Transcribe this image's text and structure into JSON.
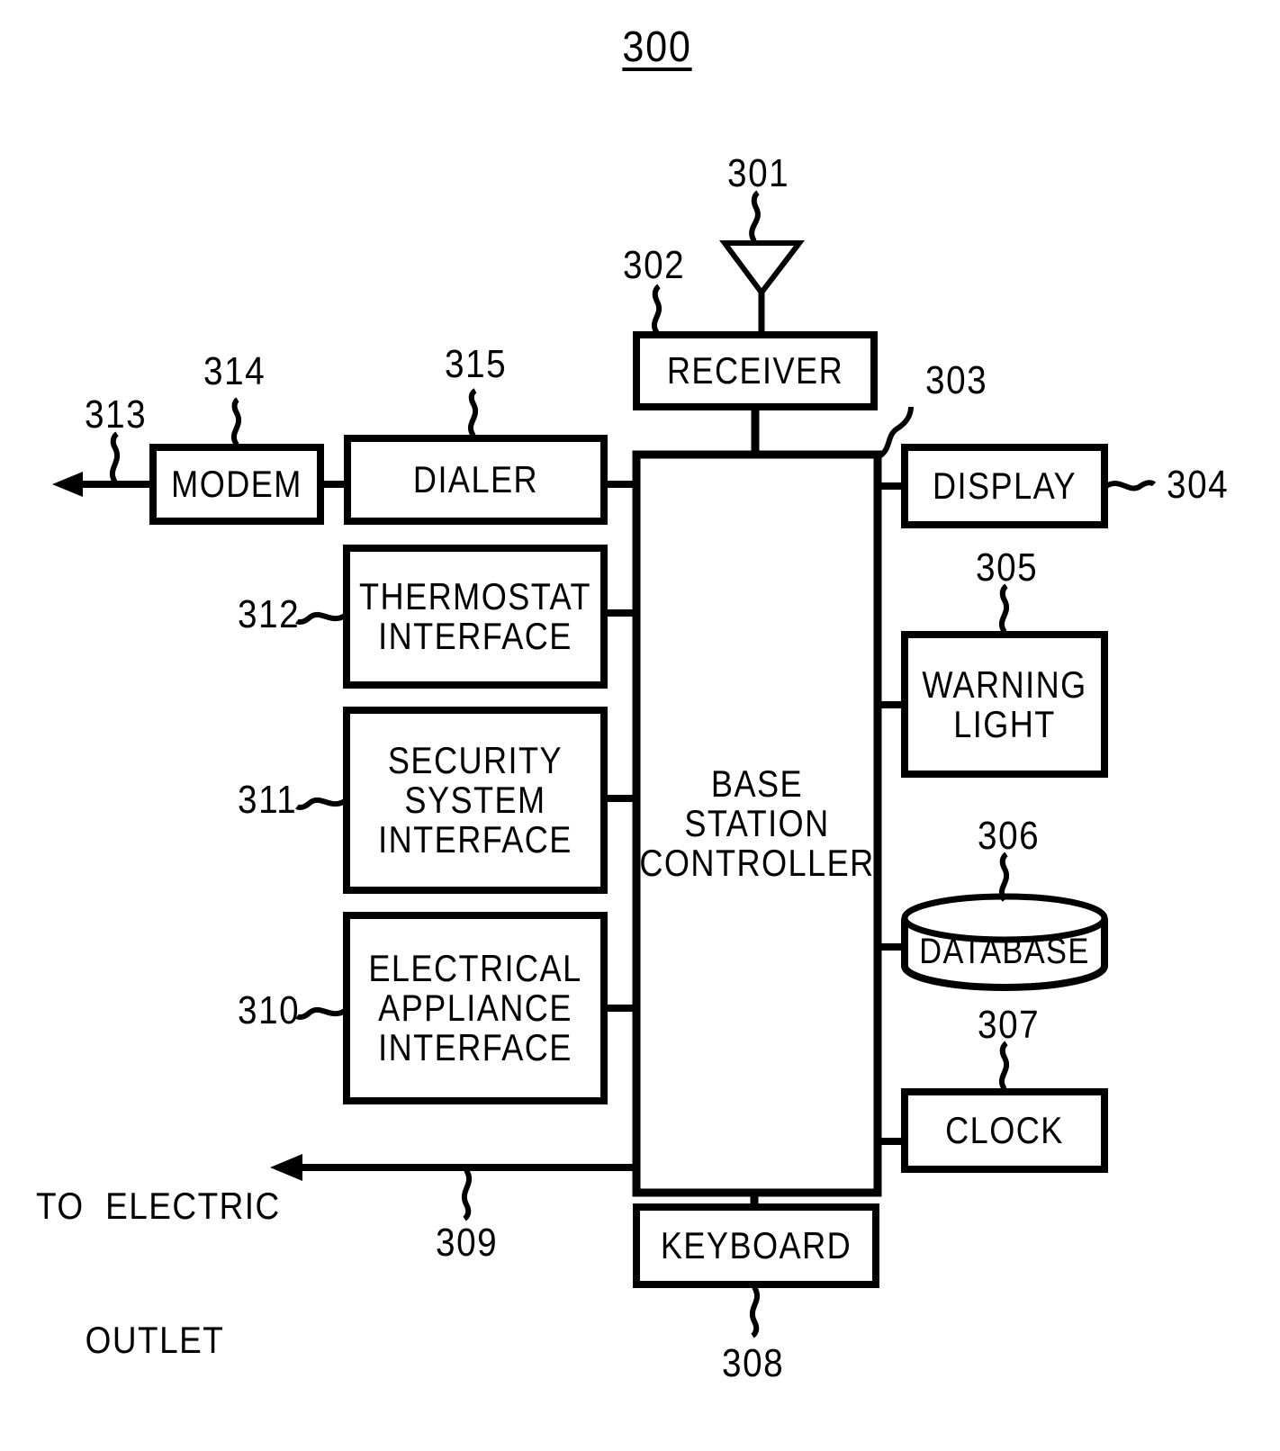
{
  "figure": {
    "number": "300",
    "type": "block-diagram",
    "title_label": "300"
  },
  "blocks": [
    {
      "id": "receiver",
      "label": "RECEIVER",
      "ref": "302",
      "shape": "rect"
    },
    {
      "id": "controller",
      "label": "BASE\nSTATION\nCONTROLLER",
      "ref": "303",
      "shape": "rect"
    },
    {
      "id": "display",
      "label": "DISPLAY",
      "ref": "304",
      "shape": "rect"
    },
    {
      "id": "warning",
      "label": "WARNING\nLIGHT",
      "ref": "305",
      "shape": "rect"
    },
    {
      "id": "database",
      "label": "DATABASE",
      "ref": "306",
      "shape": "cylinder"
    },
    {
      "id": "clock",
      "label": "CLOCK",
      "ref": "307",
      "shape": "rect"
    },
    {
      "id": "keyboard",
      "label": "KEYBOARD",
      "ref": "308",
      "shape": "rect"
    },
    {
      "id": "appliance",
      "label": "ELECTRICAL\nAPPLIANCE\nINTERFACE",
      "ref": "310",
      "shape": "rect"
    },
    {
      "id": "security",
      "label": "SECURITY\nSYSTEM\nINTERFACE",
      "ref": "311",
      "shape": "rect"
    },
    {
      "id": "thermostat",
      "label": "THERMOSTAT\nINTERFACE",
      "ref": "312",
      "shape": "rect"
    },
    {
      "id": "modem",
      "label": "MODEM",
      "ref": "314",
      "shape": "rect"
    },
    {
      "id": "dialer",
      "label": "DIALER",
      "ref": "315",
      "shape": "rect"
    }
  ],
  "block_text": {
    "receiver": "RECEIVER",
    "controller_line1": "BASE",
    "controller_line2": "STATION",
    "controller_line3": "CONTROLLER",
    "display": "DISPLAY",
    "warning_line1": "WARNING",
    "warning_line2": "LIGHT",
    "database": "DATABASE",
    "clock": "CLOCK",
    "keyboard": "KEYBOARD",
    "appliance_line1": "ELECTRICAL",
    "appliance_line2": "APPLIANCE",
    "appliance_line3": "INTERFACE",
    "security_line1": "SECURITY",
    "security_line2": "SYSTEM",
    "security_line3": "INTERFACE",
    "thermostat_line1": "THERMOSTAT",
    "thermostat_line2": "INTERFACE",
    "modem": "MODEM",
    "dialer": "DIALER"
  },
  "reference_numerals": {
    "antenna": "301",
    "receiver": "302",
    "controller": "303",
    "display": "304",
    "warning_light": "305",
    "database": "306",
    "clock": "307",
    "keyboard": "308",
    "outlet_line": "309",
    "appliance_interface": "310",
    "security_interface": "311",
    "thermostat_interface": "312",
    "modem_output_line": "313",
    "modem": "314",
    "dialer": "315"
  },
  "annotations": {
    "electric_outlet_line1": "TO  ELECTRIC",
    "electric_outlet_line2": "OUTLET"
  },
  "icons": {
    "antenna": "antenna-icon",
    "database": "database-cylinder-icon"
  },
  "colors": {
    "stroke": "#000000",
    "background": "#ffffff"
  }
}
